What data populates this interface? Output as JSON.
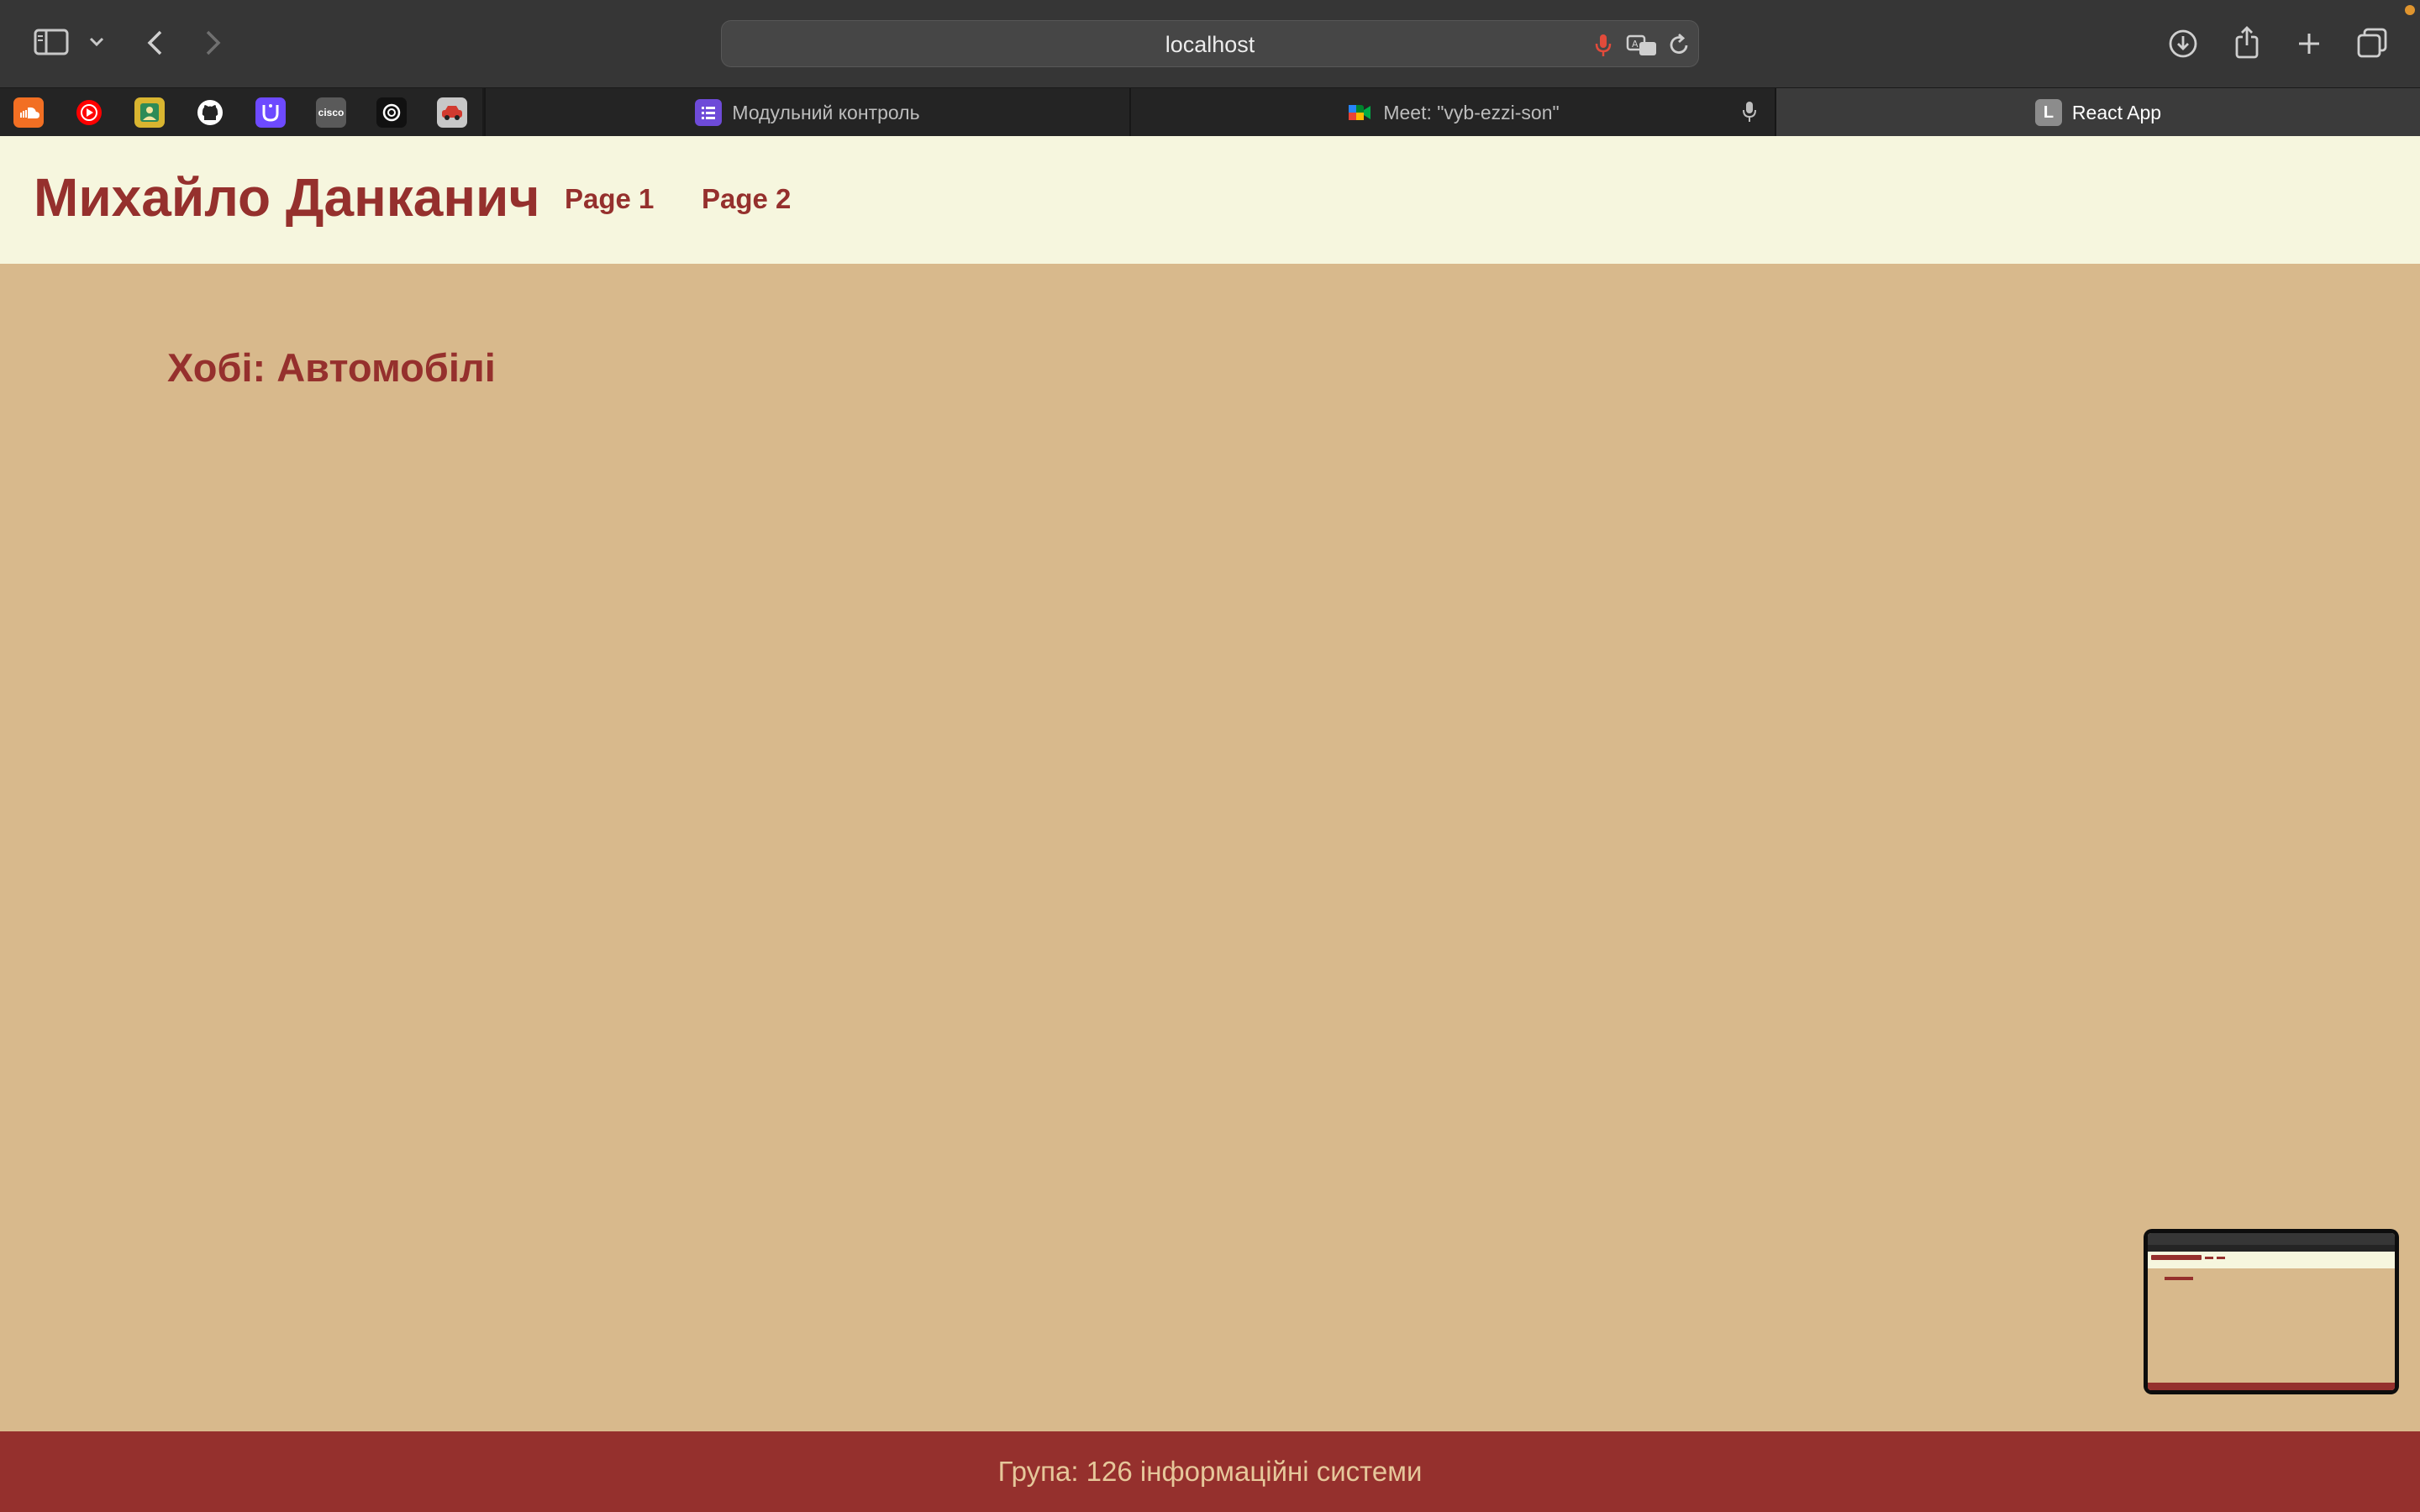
{
  "browser": {
    "url": "localhost",
    "favorites": [
      {
        "icon": "soundcloud-icon",
        "color": "#f26f23"
      },
      {
        "icon": "youtube-music-icon",
        "color": "#ff0000"
      },
      {
        "icon": "contacts-icon",
        "color": "#d9b530"
      },
      {
        "icon": "github-icon",
        "color": "#242424"
      },
      {
        "icon": "proton-icon",
        "color": "#6d4aff"
      },
      {
        "icon": "cisco-icon",
        "color": "#5a5a5a"
      },
      {
        "icon": "openai-icon",
        "color": "#111111"
      },
      {
        "icon": "car-icon",
        "color": "#c7c7c7"
      }
    ],
    "tabs": [
      {
        "label": "Модульний контроль",
        "icon": "forms-icon",
        "color": "#6e4bd8",
        "active": false
      },
      {
        "label": "Meet: \"vyb-ezzi-son\"",
        "icon": "google-meet-icon",
        "color": "#00832d",
        "active": false
      },
      {
        "label": "React App",
        "icon_letter": "L",
        "icon": "react-app-favicon",
        "color": "#8c8c8c",
        "active": true
      }
    ]
  },
  "page": {
    "title": "Михайло Данканич",
    "nav": [
      {
        "label": "Page 1"
      },
      {
        "label": "Page 2"
      }
    ],
    "hobby": "Хобі: Автомобілі",
    "footer": "Група: 126 інформаційні системи",
    "colors": {
      "header_bg": "#f6f6de",
      "body_bg": "#d8b98c",
      "accent": "#95302d",
      "footer_text": "#e6c79a"
    }
  }
}
